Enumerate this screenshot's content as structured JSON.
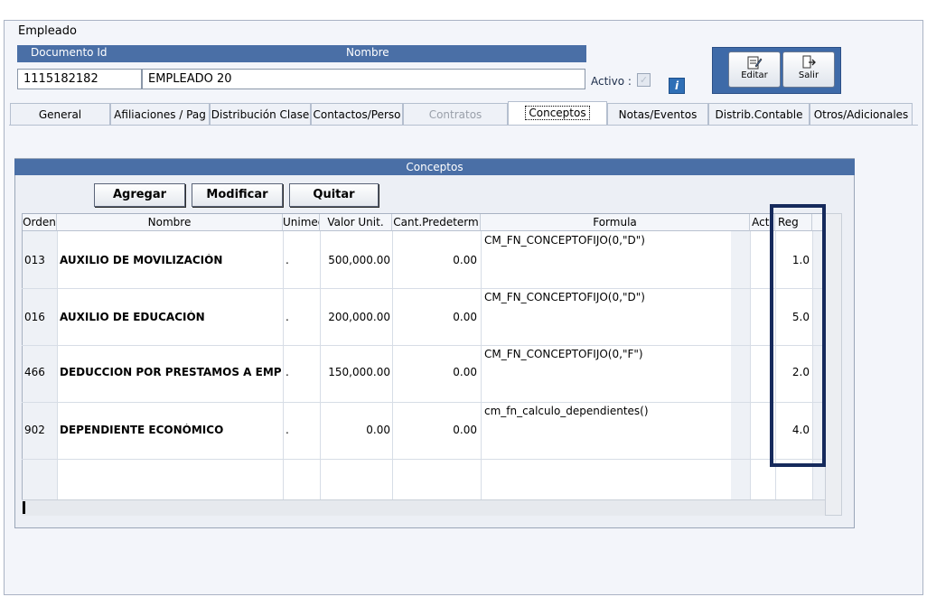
{
  "window": {
    "title": "Empleado"
  },
  "header": {
    "documento_label": "Documento Id",
    "nombre_label": "Nombre",
    "documento_value": "1115182182",
    "nombre_value": "EMPLEADO 20",
    "activo_label": "Activo :",
    "info_glyph": "i"
  },
  "toolbar": {
    "editar_label": "Editar",
    "salir_label": "Salir"
  },
  "tabs": [
    {
      "label": "General"
    },
    {
      "label": "Afiliaciones / Pag"
    },
    {
      "label": "Distribución Clase"
    },
    {
      "label": "Contactos/Perso"
    },
    {
      "label": "Contratos",
      "state": "disabled"
    },
    {
      "label": "Conceptos",
      "state": "active"
    },
    {
      "label": "Notas/Eventos"
    },
    {
      "label": "Distrib.Contable"
    },
    {
      "label": "Otros/Adicionales"
    }
  ],
  "conceptos": {
    "title": "Conceptos",
    "buttons": {
      "agregar": "Agregar",
      "modificar": "Modificar",
      "quitar": "Quitar"
    },
    "columns": [
      "Orden",
      "Nombre",
      "Unimed",
      "Valor Unit.",
      "Cant.Predeterm",
      "Formula",
      "Acti",
      "Reg"
    ],
    "rows": [
      {
        "orden": "013",
        "nombre": "AUXILIO DE MOVILIZACIÓN",
        "unimed": ".",
        "valor": "500,000.00",
        "cant": "0.00",
        "formula": "CM_FN_CONCEPTOFIJO(0,\"D\")",
        "reg": "1.0"
      },
      {
        "orden": "016",
        "nombre": "AUXILIO DE EDUCACIÓN",
        "unimed": ".",
        "valor": "200,000.00",
        "cant": "0.00",
        "formula": "CM_FN_CONCEPTOFIJO(0,\"D\")",
        "reg": "5.0"
      },
      {
        "orden": "466",
        "nombre": "DEDUCCION POR PRESTAMOS A EMPLEADOS",
        "unimed": ".",
        "valor": "150,000.00",
        "cant": "0.00",
        "formula": "CM_FN_CONCEPTOFIJO(0,\"F\")",
        "reg": "2.0"
      },
      {
        "orden": "902",
        "nombre": "DEPENDIENTE ECONÓMICO",
        "unimed": ".",
        "valor": "0.00",
        "cant": "0.00",
        "formula": "cm_fn_calculo_dependientes()",
        "reg": "4.0"
      }
    ]
  },
  "colors": {
    "header_blue": "#4a6fa6",
    "highlight_box": "#162a5c",
    "info_icon": "#2f6fb6"
  },
  "icons": {
    "editar": "edit-document-icon",
    "salir": "exit-door-icon",
    "info": "info-icon",
    "activo": "checkbox-icon"
  }
}
